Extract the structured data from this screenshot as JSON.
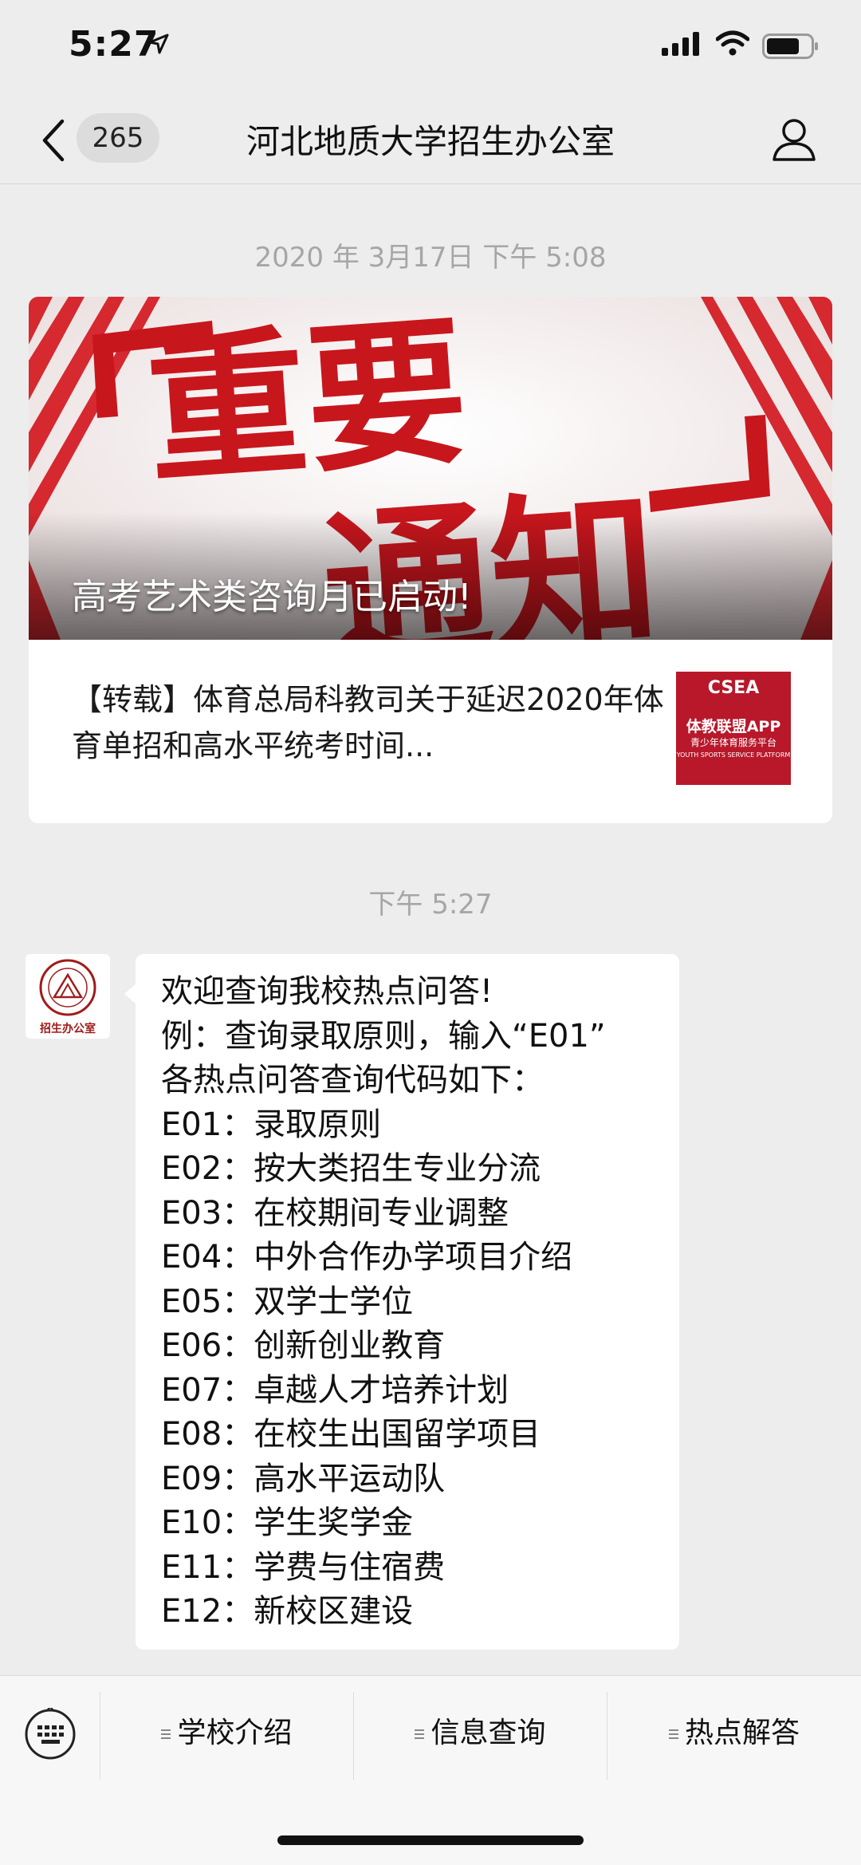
{
  "status_bar": {
    "time": "5:27"
  },
  "nav": {
    "back_count": "265",
    "title": "河北地质大学招生办公室"
  },
  "timestamp_1": "2020 年 3月17日 下午 5:08",
  "article": {
    "banner_text_top": "重要",
    "banner_text_bottom": "通知",
    "caption": "高考艺术类咨询月已启动!",
    "subtitle": "【转载】体育总局科教司关于延迟2020年体育单招和高水平统考时间...",
    "thumb": {
      "brand": "CSEA",
      "name": "体教联盟APP",
      "tagline": "青少年体育服务平台",
      "tagline_en": "YOUTH SPORTS SERVICE PLATFORM"
    }
  },
  "timestamp_2": "下午 5:27",
  "message": {
    "avatar_caption": "招生办公室",
    "lines": [
      "欢迎查询我校热点问答!",
      "例：查询录取原则，输入“E01”",
      "各热点问答查询代码如下：",
      "E01：录取原则",
      "E02：按大类招生专业分流",
      "E03：在校期间专业调整",
      "E04：中外合作办学项目介绍",
      "E05：双学士学位",
      "E06：创新创业教育",
      "E07：卓越人才培养计划",
      "E08：在校生出国留学项目",
      "E09：高水平运动队",
      "E10：学生奖学金",
      "E11：学费与住宿费",
      "E12：新校区建设"
    ]
  },
  "menu": {
    "items": [
      "学校介绍",
      "信息查询",
      "热点解答"
    ]
  },
  "colors": {
    "background": "#ededed",
    "banner_red": "#c8161d",
    "thumb_red": "#b8182a"
  }
}
